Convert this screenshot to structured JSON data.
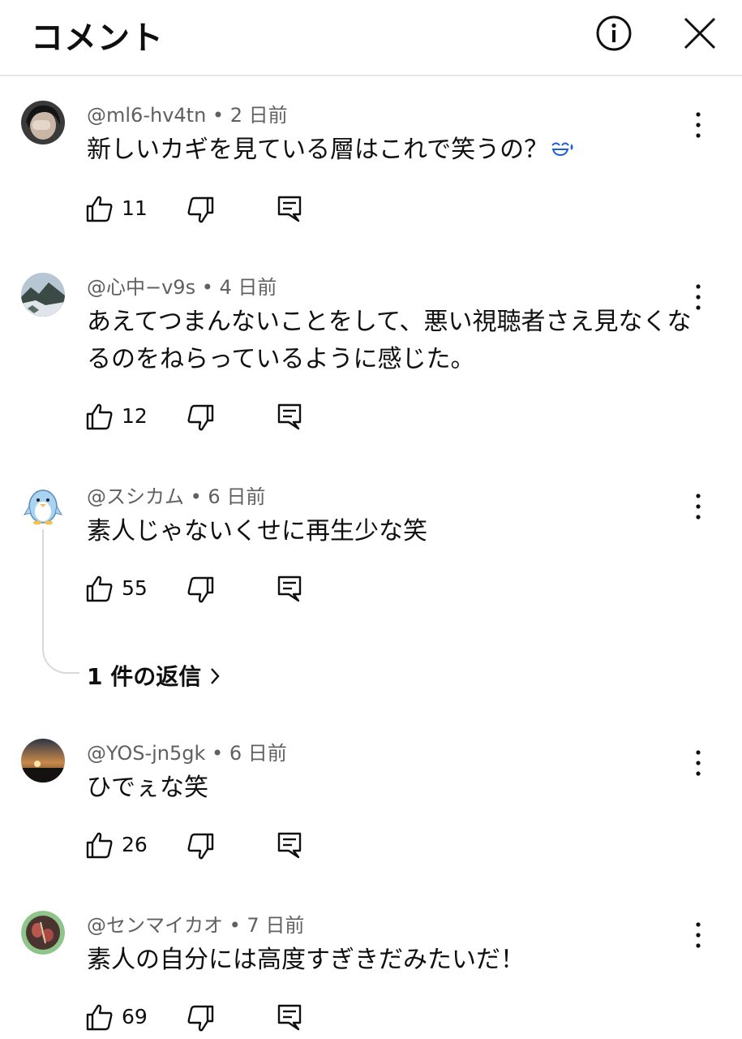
{
  "header": {
    "title": "コメント"
  },
  "comments": [
    {
      "author": "@ml6-hv4tn",
      "time": "2 日前",
      "text": "新しいカギを見ている層はこれで笑うの？",
      "emoji": "sweat-smile-emoji",
      "likes": "11"
    },
    {
      "author": "@心中−v9s",
      "time": "4 日前",
      "text": "あえてつまんないことをして、悪い視聴者さえ見なくなるのをねらっているように感じた。",
      "likes": "12"
    },
    {
      "author": "@スシカム",
      "time": "6 日前",
      "text": "素人じゃないくせに再生少な笑",
      "likes": "55",
      "replies": "1 件の返信"
    },
    {
      "author": "@YOS-jn5gk",
      "time": "6 日前",
      "text": "ひでぇな笑",
      "likes": "26"
    },
    {
      "author": "@センマイカオ",
      "time": "7 日前",
      "text": "素人の自分には高度すぎきだみたいだ！",
      "likes": "69"
    }
  ],
  "separator": " • ",
  "colors": {
    "text": "#0f0f0f",
    "meta": "#606060",
    "emoji": "#1a5fd6"
  }
}
